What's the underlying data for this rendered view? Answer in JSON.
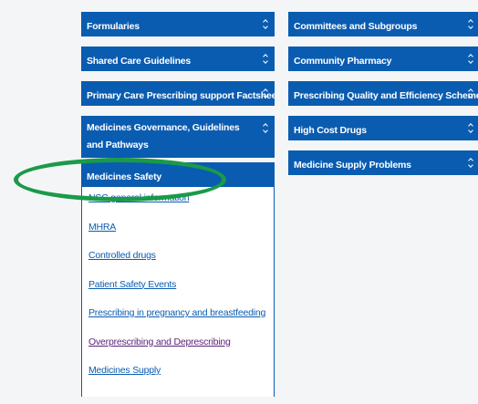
{
  "left_column": {
    "buttons": [
      {
        "label": "Formularies"
      },
      {
        "label": "Shared Care Guidelines"
      },
      {
        "label": "Primary Care Prescribing support Factsheets"
      },
      {
        "label": "Medicines Governance, Guidelines and Pathways"
      },
      {
        "label": "Medicines Safety"
      }
    ],
    "medicines_safety_links": [
      {
        "label": "NSC general information"
      },
      {
        "label": "MHRA"
      },
      {
        "label": "Controlled drugs"
      },
      {
        "label": "Patient Safety Events"
      },
      {
        "label": "Prescribing in pregnancy and breastfeeding"
      },
      {
        "label": "Overprescribing and Deprescribing"
      },
      {
        "label": "Medicines Supply"
      }
    ]
  },
  "right_column": {
    "buttons": [
      {
        "label": "Committees and Subgroups"
      },
      {
        "label": "Community Pharmacy"
      },
      {
        "label": "Prescribing Quality and Efficiency Scheme"
      },
      {
        "label": "High Cost Drugs"
      },
      {
        "label": "Medicine Supply Problems"
      }
    ]
  },
  "colors": {
    "accent": "#0a5cb1",
    "visited_link": "#5a2378",
    "highlight": "#1a9a4a"
  },
  "icons": [
    "chevron-up-down-icon"
  ]
}
